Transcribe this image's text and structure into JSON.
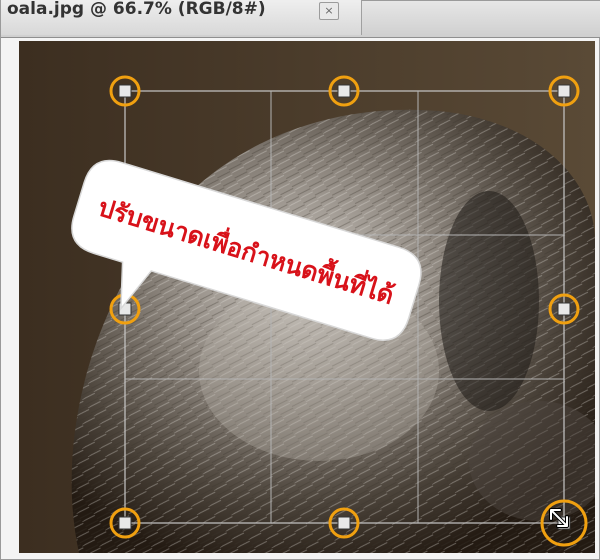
{
  "window": {
    "tab_title": "oala.jpg @ 66.7% (RGB/8#)",
    "tab_close_label": "×"
  },
  "annotation": {
    "text": "ปรับขนาดเพื่อกำหนดพื้นที่ได้",
    "color": "#d8121a"
  },
  "crop": {
    "handle_color": "#f0a010",
    "grid": "3x3"
  },
  "icons": {
    "handles": "crop-handle-icon",
    "resize": "diagonal-resize-cursor-icon"
  }
}
